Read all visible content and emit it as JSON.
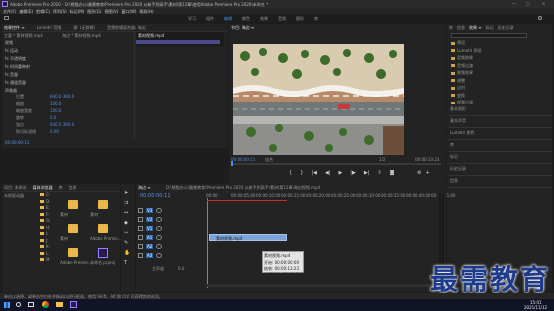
{
  "window": {
    "title": "Adobe Premiere Pro 2020 - D:\\熊猫办公\\最需教育\\Premiere Pro 2020 从新手到高手\\素材\\第12章\\使用Adobe Premiere Pro 2020\\未命名 *",
    "controls": [
      "—",
      "□",
      "✕"
    ]
  },
  "menu": [
    "文件(F)",
    "编辑(E)",
    "剪辑(C)",
    "序列(S)",
    "标记(M)",
    "图形(G)",
    "视图(V)",
    "窗口(W)",
    "帮助(H)"
  ],
  "workspaces": [
    "学习",
    "组件",
    "编辑",
    "颜色",
    "效果",
    "音频",
    "图形",
    "库"
  ],
  "active_workspace": "编辑",
  "effect_controls": {
    "tabs": [
      "效果控件 ≡",
      "Lumetri 范围",
      "源: (无剪辑)",
      "音频剪辑混合器: 海边"
    ],
    "master": "主要 * 素材视频.mp4",
    "seq": "海边 * 素材视频.mp4",
    "clip_label": "素材视频.mp4",
    "sections": [
      "视频",
      "fx 运动",
      "fx 不透明度",
      "fx 时间重映射",
      "fx 音量",
      "fx 通道音量",
      "声像器"
    ],
    "props": [
      {
        "name": "位置",
        "value": "640.0  360.0"
      },
      {
        "name": "缩放",
        "value": "100.0"
      },
      {
        "name": "缩放宽度",
        "value": "100.0"
      },
      {
        "name": "旋转",
        "value": "0.0"
      },
      {
        "name": "锚点",
        "value": "640.0  360.0"
      },
      {
        "name": "防闪烁滤镜",
        "value": "0.00"
      }
    ],
    "timecode": "00:00:00:11"
  },
  "program": {
    "tab": "节目: 海边 ≡",
    "timecode": "00:00:00:11",
    "fit": "适合",
    "zoom": "1/2",
    "duration": "00:00:13:23"
  },
  "library": {
    "tabs": [
      "库",
      "信息",
      "效果 ≡",
      "标记",
      "历史记录"
    ],
    "search_placeholder": "",
    "folders": [
      "预设",
      "Lumetri 预设",
      "音频效果",
      "音频过渡",
      "视频效果",
      "调整",
      "过时",
      "变换",
      "视频过渡"
    ]
  },
  "side_panels": [
    "基本图形",
    "基本声音",
    "Lumetri 颜色",
    "库",
    "标记",
    "历史记录",
    "信息"
  ],
  "project": {
    "tabs": [
      "项目: 未命名",
      "媒体浏览器",
      "库",
      "信息"
    ],
    "tree_root": "本地驱动器",
    "tree_items": [
      "C:",
      "D:",
      "E:",
      "F:",
      "G:",
      "H:",
      "I:",
      "J:",
      "K:",
      "L:",
      "M:"
    ],
    "items": [
      {
        "name": "素材",
        "type": "folder"
      },
      {
        "name": "素材",
        "type": "folder"
      },
      {
        "name": "素材",
        "type": "folder"
      },
      {
        "name": "Adobe Premie...",
        "type": "folder"
      },
      {
        "name": "Adobe Premie...",
        "type": "folder"
      },
      {
        "name": "未命名.prproj",
        "type": "project"
      }
    ],
    "selected_label": "海边"
  },
  "timeline": {
    "tab": "海边 ≡",
    "path": "D:\\熊猫办公\\最需教育\\Premiere Pro 2020 从新手到高手\\素材\\第12章\\海边视频.mp4",
    "timecode": "00:00:00:11",
    "ruler": [
      "00:00",
      "00:00:05:00",
      "00:00:10:00",
      "00:00:15:00",
      "00:00:20:00",
      "00:00:25:00",
      "00:00:30:00",
      "00:00:35:00",
      "00:00:40:00",
      "00:00:45:00"
    ],
    "tracks_video": [
      "V3",
      "V2",
      "V1"
    ],
    "tracks_audio": [
      "A1",
      "A2",
      "A3"
    ],
    "master": "主声道",
    "master_value": "0.0",
    "clip": "素材视频.mp4",
    "tooltip": {
      "name": "素材视频.mp4",
      "start": "开始: 00:00:00:00",
      "end": "结束: 00:00:13:23",
      "dur": "持续时间: 00:00:13:24"
    }
  },
  "status": "单击以选择，或单击空白处并拖动以进行框选。使用 Shift、Alt 和 Ctrl 可获得其他选项。",
  "taskbar": {
    "time": "15:01",
    "date": "2021/11/12"
  },
  "watermark": "最需教育",
  "colors": {
    "accent": "#2d8ceb",
    "playhead": "#4a8fe0",
    "clip": "#7aa3d6",
    "folder": "#e8b84a"
  }
}
